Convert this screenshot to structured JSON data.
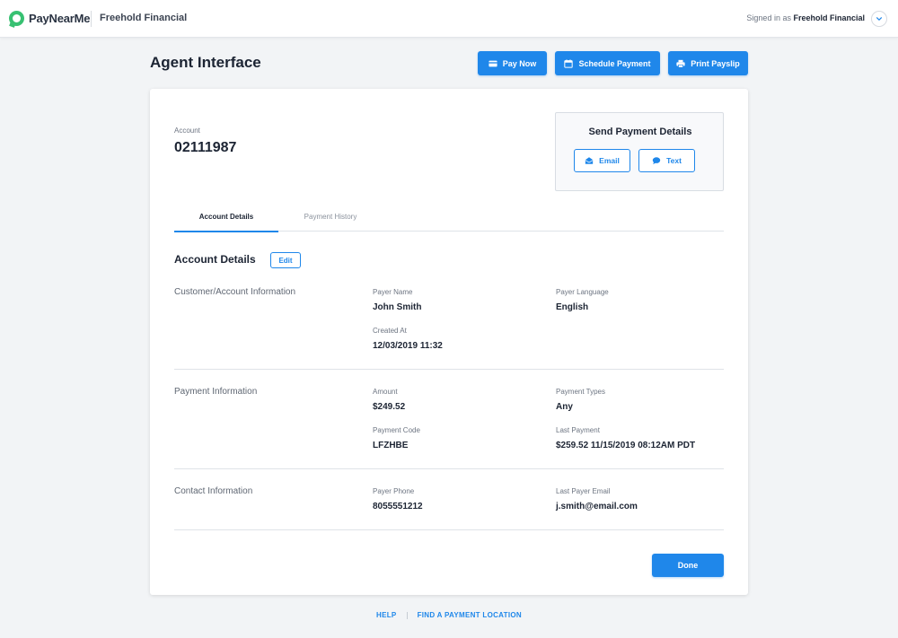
{
  "topbar": {
    "brand": "PayNearMe",
    "org": "Freehold Financial",
    "signed_in_prefix": "Signed in as",
    "signed_in_user": "Freehold Financial",
    "menu_icon": "chevron-down-icon"
  },
  "header": {
    "title": "Agent Interface",
    "buttons": {
      "pay_now": "Pay Now",
      "schedule_payment": "Schedule Payment",
      "print_payslip": "Print Payslip"
    }
  },
  "account": {
    "label": "Account",
    "number": "02111987"
  },
  "send_details": {
    "title": "Send Payment Details",
    "email": "Email",
    "text": "Text"
  },
  "tabs": [
    {
      "label": "Account Details",
      "active": true
    },
    {
      "label": "Payment History",
      "active": false
    }
  ],
  "details": {
    "title": "Account Details",
    "edit": "Edit",
    "sections": {
      "customer": {
        "label": "Customer/Account Information",
        "payer_name_label": "Payer Name",
        "payer_name": "John Smith",
        "payer_language_label": "Payer Language",
        "payer_language": "English",
        "created_at_label": "Created At",
        "created_at": "12/03/2019 11:32"
      },
      "payment": {
        "label": "Payment Information",
        "amount_label": "Amount",
        "amount": "$249.52",
        "payment_types_label": "Payment Types",
        "payment_types": "Any",
        "payment_code_label": "Payment Code",
        "payment_code": "LFZHBE",
        "last_payment_label": "Last Payment",
        "last_payment": "$259.52 11/15/2019 08:12AM PDT"
      },
      "contact": {
        "label": "Contact Information",
        "payer_phone_label": "Payer Phone",
        "payer_phone": "8055551212",
        "last_payer_email_label": "Last Payer Email",
        "last_payer_email": "j.smith@email.com"
      }
    },
    "done": "Done"
  },
  "footer": {
    "help": "HELP",
    "find_location": "FIND A PAYMENT LOCATION"
  },
  "colors": {
    "accent": "#1f87ea",
    "brand_green": "#38c172"
  }
}
